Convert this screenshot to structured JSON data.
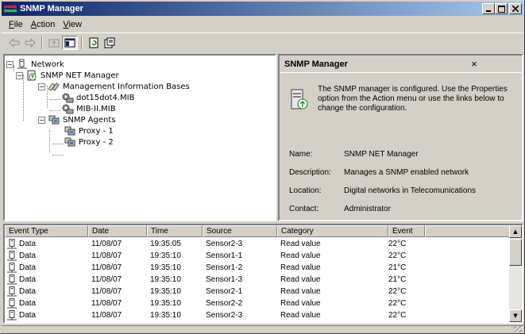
{
  "window": {
    "title": "SNMP Manager"
  },
  "menu": {
    "items": [
      {
        "label": "File",
        "accel": "F",
        "rest": "ile"
      },
      {
        "label": "Action",
        "accel": "A",
        "rest": "ction"
      },
      {
        "label": "View",
        "accel": "V",
        "rest": "iew"
      }
    ]
  },
  "toolbar": {
    "icons": [
      "back-arrow-icon",
      "forward-arrow-icon",
      "up-folder-icon",
      "show-hide-console-tree-icon",
      "refresh-icon",
      "properties-icon"
    ]
  },
  "tree": {
    "nodes": [
      {
        "label": "Network",
        "icon": "network-computer-icon"
      },
      {
        "label": "SNMP NET Manager",
        "icon": "snmp-manager-icon"
      },
      {
        "label": "Management Information Bases",
        "icon": "mib-folder-icon"
      },
      {
        "label": "dot15dot4.MIB",
        "icon": "mib-file-icon"
      },
      {
        "label": "MIB-II.MIB",
        "icon": "mib-file-icon"
      },
      {
        "label": "SNMP Agents",
        "icon": "agents-icon"
      },
      {
        "label": "Proxy - 1",
        "icon": "agent-icon"
      },
      {
        "label": "Proxy - 2",
        "icon": "agent-icon"
      }
    ]
  },
  "detail": {
    "title": "SNMP Manager",
    "close": "×",
    "description": "The SNMP manager is configured. Use the Properties option from the Action menu or use the links below to change the configuration.",
    "properties": [
      {
        "label": "Name:",
        "value": "SNMP NET Manager"
      },
      {
        "label": "Description:",
        "value": "Manages a SNMP enabled network"
      },
      {
        "label": "Location:",
        "value": "Digital networks in Telecomunications"
      },
      {
        "label": "Contact:",
        "value": "Administrator"
      }
    ]
  },
  "events": {
    "columns": [
      "Event Type",
      "Date",
      "Time",
      "Source",
      "Category",
      "Event",
      ""
    ],
    "rows": [
      [
        "Data",
        "11/08/07",
        "19:35:05",
        "Sensor2-3",
        "Read value",
        "22°C"
      ],
      [
        "Data",
        "11/08/07",
        "19:35:10",
        "Sensor1-1",
        "Read value",
        "22°C"
      ],
      [
        "Data",
        "11/08/07",
        "19:35:10",
        "Sensor1-2",
        "Read value",
        "21°C"
      ],
      [
        "Data",
        "11/08/07",
        "19:35:10",
        "Sensor1-3",
        "Read value",
        "21°C"
      ],
      [
        "Data",
        "11/08/07",
        "19:35:10",
        "Sensor2-1",
        "Read value",
        "22°C"
      ],
      [
        "Data",
        "11/08/07",
        "19:35:10",
        "Sensor2-2",
        "Read value",
        "22°C"
      ],
      [
        "Data",
        "11/08/07",
        "19:35:10",
        "Sensor2-3",
        "Read value",
        "22°C"
      ]
    ]
  },
  "colors": {
    "title_start": "#0a246a",
    "title_end": "#a6caf0",
    "face": "#d4d0c8"
  }
}
